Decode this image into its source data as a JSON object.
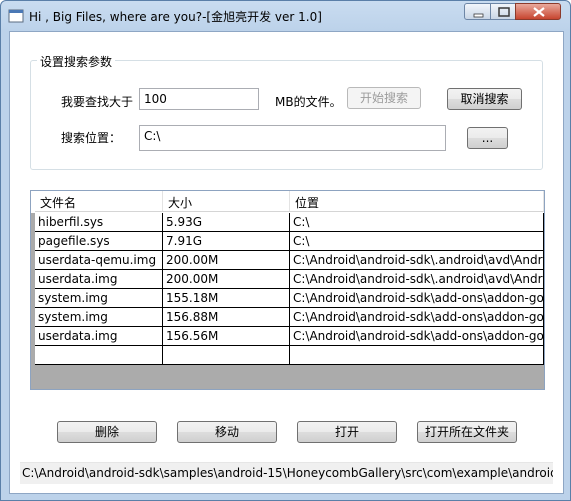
{
  "window": {
    "title": "Hi , Big Files, where are you?-[金旭亮开发 ver 1.0]"
  },
  "search_settings": {
    "group_title": "设置搜索参数",
    "size_label": "我要查找大于",
    "size_value": "100",
    "size_unit_label": "MB的文件。",
    "start_button": "开始搜索",
    "cancel_button": "取消搜索",
    "location_label": "搜索位置：",
    "location_value": "C:\\",
    "browse_button": "..."
  },
  "table": {
    "columns": [
      "文件名",
      "大小",
      "位置"
    ],
    "rows": [
      {
        "name": "hiberfil.sys",
        "size": "5.93G",
        "location": "C:\\"
      },
      {
        "name": "pagefile.sys",
        "size": "7.91G",
        "location": "C:\\"
      },
      {
        "name": "userdata-qemu.img",
        "size": "200.00M",
        "location": "C:\\Android\\android-sdk\\.android\\avd\\Andr"
      },
      {
        "name": "userdata.img",
        "size": "200.00M",
        "location": "C:\\Android\\android-sdk\\.android\\avd\\Andr"
      },
      {
        "name": "system.img",
        "size": "155.18M",
        "location": "C:\\Android\\android-sdk\\add-ons\\addon-go"
      },
      {
        "name": "system.img",
        "size": "156.88M",
        "location": "C:\\Android\\android-sdk\\add-ons\\addon-go"
      },
      {
        "name": "userdata.img",
        "size": "156.56M",
        "location": "C:\\Android\\android-sdk\\add-ons\\addon-go"
      },
      {
        "name": "",
        "size": "",
        "location": ""
      }
    ]
  },
  "actions": {
    "delete": "删除",
    "move": "移动",
    "open": "打开",
    "open_folder": "打开所在文件夹"
  },
  "status": {
    "text": "C:\\Android\\android-sdk\\samples\\android-15\\HoneycombGallery\\src\\com\\example\\android\\"
  }
}
